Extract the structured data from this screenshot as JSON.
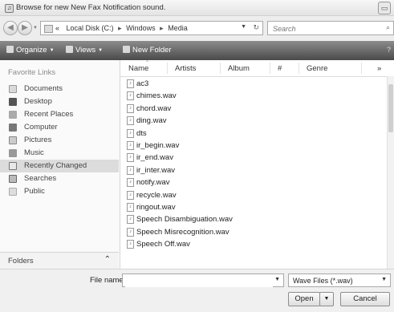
{
  "window": {
    "title": "Browse for new New Fax Notification sound.",
    "close_glyph": "▭"
  },
  "address": {
    "prefix": "«",
    "crumbs": [
      "Local Disk (C:)",
      "Windows",
      "Media"
    ],
    "separator": "▸",
    "search_placeholder": "Search"
  },
  "toolbar": {
    "organize_label": "Organize",
    "views_label": "Views",
    "new_folder_label": "New Folder"
  },
  "nav": {
    "heading": "Favorite Links",
    "items": [
      {
        "label": "Documents",
        "icon": "documents-icon",
        "cls": "ic-doc",
        "selected": false
      },
      {
        "label": "Desktop",
        "icon": "desktop-icon",
        "cls": "ic-desk",
        "selected": false
      },
      {
        "label": "Recent Places",
        "icon": "recent-places-icon",
        "cls": "ic-place",
        "selected": false
      },
      {
        "label": "Computer",
        "icon": "computer-icon",
        "cls": "ic-comp",
        "selected": false
      },
      {
        "label": "Pictures",
        "icon": "pictures-icon",
        "cls": "ic-pic",
        "selected": false
      },
      {
        "label": "Music",
        "icon": "music-icon",
        "cls": "ic-music",
        "selected": false
      },
      {
        "label": "Recently Changed",
        "icon": "recently-changed-icon",
        "cls": "ic-changed",
        "selected": true
      },
      {
        "label": "Searches",
        "icon": "searches-icon",
        "cls": "ic-search",
        "selected": false
      },
      {
        "label": "Public",
        "icon": "public-icon",
        "cls": "ic-public",
        "selected": false
      }
    ],
    "folders_label": "Folders"
  },
  "columns": {
    "name": "Name",
    "artists": "Artists",
    "album": "Album",
    "number": "#",
    "genre": "Genre",
    "more": "»"
  },
  "files": [
    "ac3",
    "chimes.wav",
    "chord.wav",
    "ding.wav",
    "dts",
    "ir_begin.wav",
    "ir_end.wav",
    "ir_inter.wav",
    "notify.wav",
    "recycle.wav",
    "ringout.wav",
    "Speech Disambiguation.wav",
    "Speech Misrecognition.wav",
    "Speech Off.wav"
  ],
  "bottom": {
    "file_name_label": "File name:",
    "file_name_value": "",
    "filter_value": "Wave Files (*.wav)",
    "open_label": "Open",
    "cancel_label": "Cancel"
  }
}
